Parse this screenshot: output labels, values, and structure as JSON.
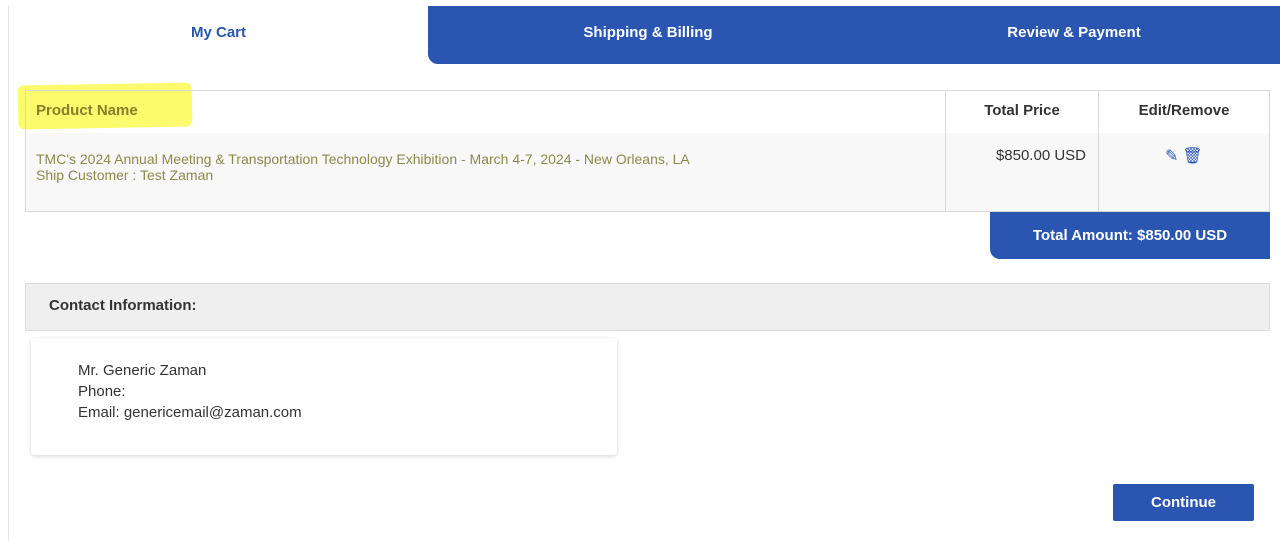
{
  "tabs": [
    {
      "label": "My Cart",
      "active": true
    },
    {
      "label": "Shipping & Billing",
      "active": false
    },
    {
      "label": "Review & Payment",
      "active": false
    }
  ],
  "cart": {
    "headers": {
      "product_name": "Product Name",
      "total_price": "Total Price",
      "edit_remove": "Edit/Remove"
    },
    "items": [
      {
        "product": "TMC's 2024 Annual Meeting & Transportation Technology Exhibition - March 4-7, 2024 - New Orleans, LA",
        "ship_customer": "Ship Customer : Test Zaman",
        "price": "$850.00 USD",
        "icons": [
          "pencil-icon",
          "trash-icon"
        ]
      }
    ],
    "total_label": "Total Amount: $850.00 USD"
  },
  "contact": {
    "heading": "Contact Information:",
    "name": "Mr. Generic Zaman",
    "phone": "Phone:",
    "email": "Email: genericemail@zaman.com"
  },
  "actions": {
    "continue_label": "Continue"
  },
  "colors": {
    "primary": "#2a55b0",
    "highlight": "#fafa3c"
  }
}
